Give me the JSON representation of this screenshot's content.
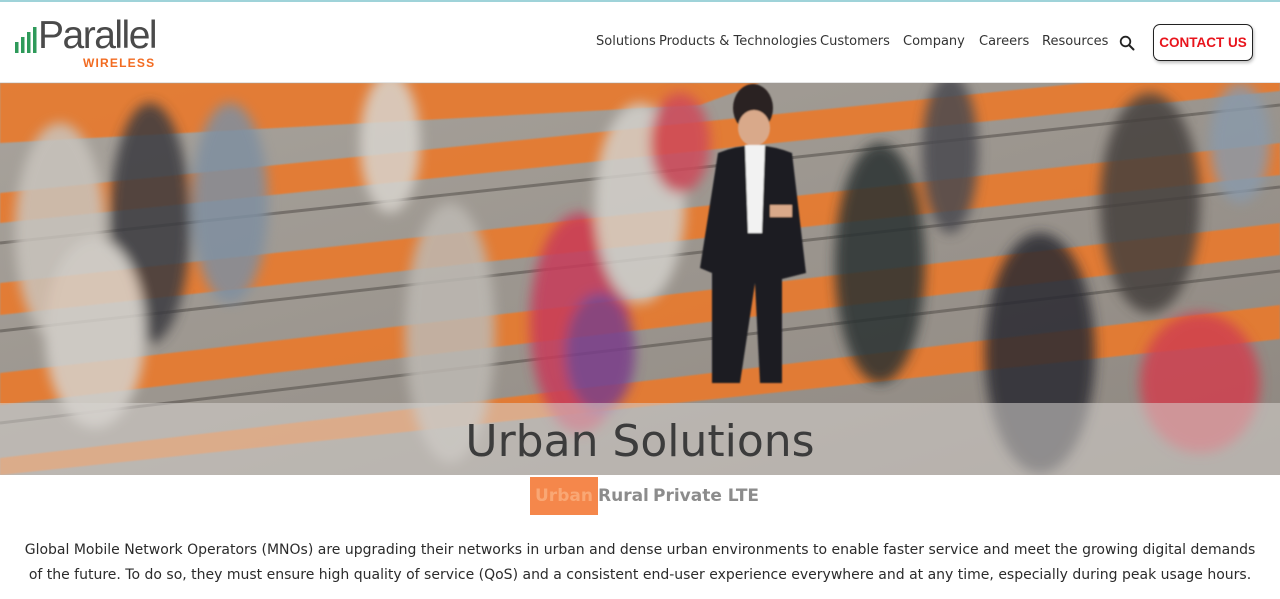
{
  "brand": {
    "name": "Parallel",
    "tagline": "WIRELESS",
    "accent_color": "#f26b21",
    "bars_color": "#2e8b57"
  },
  "nav": {
    "items": [
      {
        "label": "Solutions"
      },
      {
        "label": "Products & Technologies"
      },
      {
        "label": "Customers"
      },
      {
        "label": "Company"
      },
      {
        "label": "Careers"
      },
      {
        "label": "Resources"
      }
    ],
    "search_icon": "search-icon",
    "contact_label": "CONTACT US",
    "contact_color": "#e8141c"
  },
  "hero": {
    "title": "Urban Solutions"
  },
  "tabs": {
    "items": [
      {
        "label": "Urban",
        "active": true
      },
      {
        "label": "Rural",
        "active": false
      },
      {
        "label": "Private LTE",
        "active": false
      }
    ],
    "active_color": "#f5874b"
  },
  "intro": {
    "text": "Global Mobile Network Operators (MNOs) are upgrading their networks in urban and dense urban environments to enable faster service and meet the growing digital demands of the future. To do so, they must ensure high quality of service (QoS) and a consistent end-user experience everywhere and at any time, especially during peak usage hours."
  }
}
